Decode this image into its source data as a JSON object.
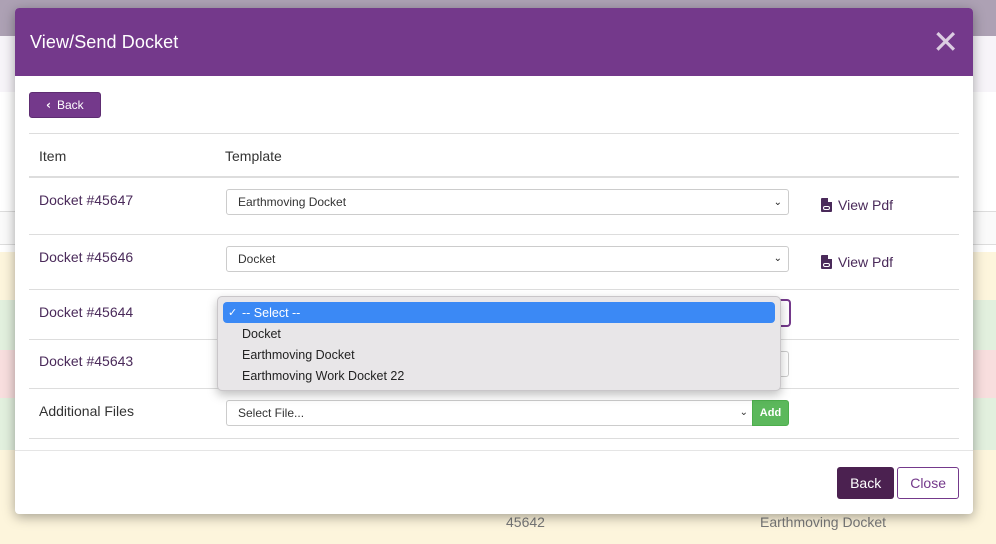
{
  "background": {
    "row_number": "45642",
    "row_template": "Earthmoving Docket"
  },
  "modal": {
    "title": "View/Send Docket",
    "back_top_label": "Back",
    "table": {
      "headers": {
        "item": "Item",
        "template": "Template"
      },
      "rows": [
        {
          "item": "Docket #45647",
          "template": "Earthmoving Docket",
          "pdf_label": "View Pdf"
        },
        {
          "item": "Docket #45646",
          "template": "Docket",
          "pdf_label": "View Pdf"
        },
        {
          "item": "Docket #45644",
          "template": ""
        },
        {
          "item": "Docket #45643",
          "template": ""
        }
      ],
      "additional_files": {
        "label": "Additional Files",
        "placeholder": "Select File...",
        "add_label": "Add"
      }
    },
    "dropdown": {
      "options": [
        "-- Select --",
        "Docket",
        "Earthmoving Docket",
        "Earthmoving Work Docket 22"
      ],
      "selected_index": 0
    },
    "footer": {
      "back_label": "Back",
      "close_label": "Close"
    }
  },
  "colors": {
    "primary": "#74398b",
    "dark_primary": "#4b2150",
    "success": "#5cb85c",
    "highlight": "#3b89f5"
  }
}
